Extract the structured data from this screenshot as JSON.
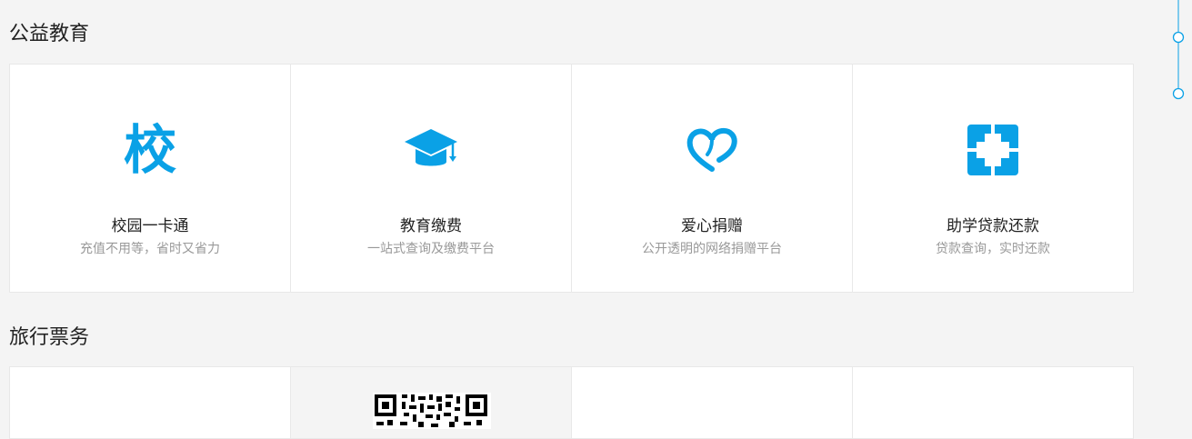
{
  "sections": [
    {
      "title": "公益教育",
      "items": [
        {
          "title": "校园一卡通",
          "desc": "充值不用等，省时又省力",
          "icon": "school-icon",
          "glyph": "校"
        },
        {
          "title": "教育缴费",
          "desc": "一站式查询及缴费平台",
          "icon": "graduation-cap-icon"
        },
        {
          "title": "爱心捐赠",
          "desc": "公开透明的网络捐赠平台",
          "icon": "heart-icon"
        },
        {
          "title": "助学贷款还款",
          "desc": "贷款查询，实时还款",
          "icon": "loan-cross-icon"
        }
      ]
    },
    {
      "title": "旅行票务",
      "items": [
        {
          "icon": ""
        },
        {
          "icon": "qr-code-icon"
        },
        {
          "icon": ""
        },
        {
          "icon": ""
        }
      ]
    }
  ],
  "colors": {
    "accent": "#0aa1e6",
    "background": "#f4f4f4",
    "card": "#ffffff"
  }
}
